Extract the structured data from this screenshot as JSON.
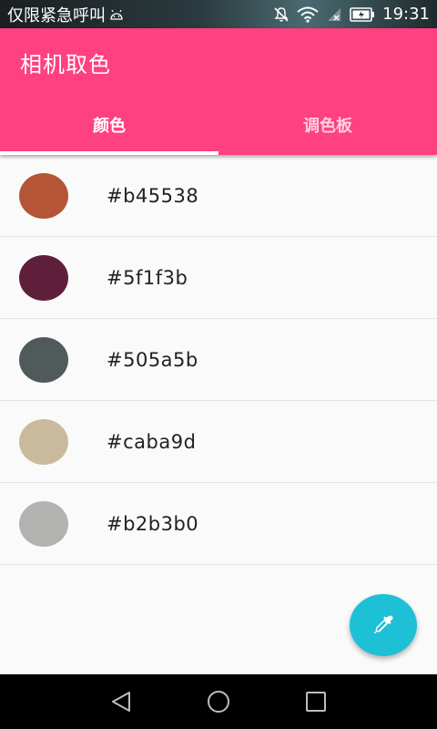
{
  "status_bar": {
    "carrier_text": "仅限紧急呼叫",
    "time": "19:31",
    "icons": [
      "android-icon",
      "mute-icon",
      "wifi-icon",
      "no-signal-icon",
      "battery-icon"
    ]
  },
  "app_bar": {
    "title": "相机取色",
    "background_color": "#ff4081"
  },
  "tabs": [
    {
      "label": "颜色",
      "active": true
    },
    {
      "label": "调色板",
      "active": false
    }
  ],
  "colors": [
    {
      "hex": "#b45538"
    },
    {
      "hex": "#5f1f3b"
    },
    {
      "hex": "#505a5b"
    },
    {
      "hex": "#caba9d"
    },
    {
      "hex": "#b2b3b0"
    }
  ],
  "fab": {
    "icon": "eyedropper-icon",
    "color": "#1ec0d6"
  },
  "nav_bar": {
    "buttons": [
      "back-icon",
      "home-icon",
      "recents-icon"
    ]
  }
}
